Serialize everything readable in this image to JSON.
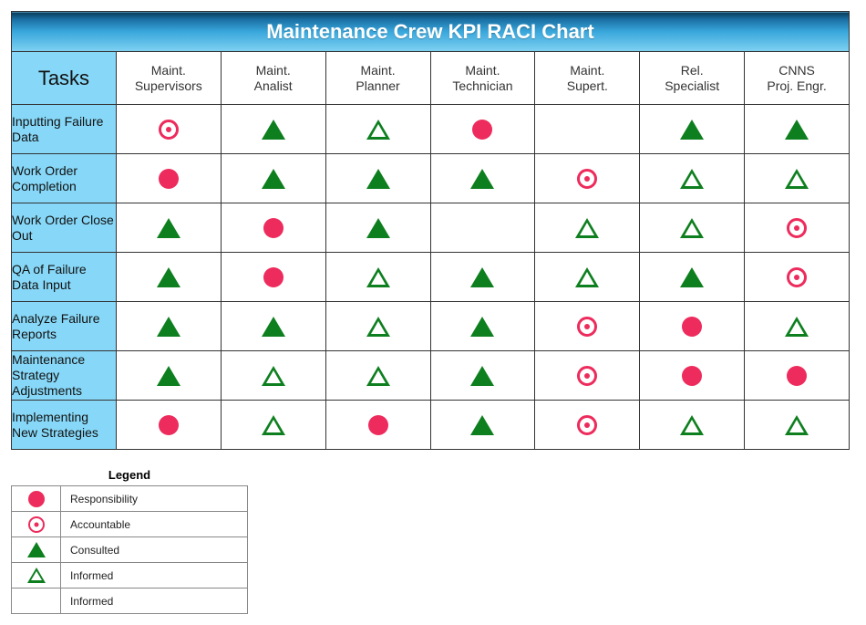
{
  "title": "Maintenance Crew KPI RACI Chart",
  "tasks_header": "Tasks",
  "roles": [
    "Maint. Supervisors",
    "Maint. Analist",
    "Maint. Planner",
    "Maint. Technician",
    "Maint. Supert.",
    "Rel. Specialist",
    "CNNS Proj. Engr."
  ],
  "tasks": [
    "Inputting Failure Data",
    "Work Order Completion",
    "Work Order Close Out",
    "QA of Failure Data Input",
    "Analyze Failure Reports",
    "Maintenance Strategy Adjustments",
    "Implementing New Strategies"
  ],
  "matrix": [
    [
      "accountable",
      "consulted",
      "informed",
      "responsibility",
      "",
      "consulted",
      "consulted"
    ],
    [
      "responsibility",
      "consulted",
      "consulted",
      "consulted",
      "accountable",
      "informed",
      "informed"
    ],
    [
      "consulted",
      "responsibility",
      "consulted",
      "",
      "informed",
      "informed",
      "accountable"
    ],
    [
      "consulted",
      "responsibility",
      "informed",
      "consulted",
      "informed",
      "consulted",
      "accountable"
    ],
    [
      "consulted",
      "consulted",
      "informed",
      "consulted",
      "accountable",
      "responsibility",
      "informed"
    ],
    [
      "consulted",
      "informed",
      "informed",
      "consulted",
      "accountable",
      "responsibility",
      "responsibility"
    ],
    [
      "responsibility",
      "informed",
      "responsibility",
      "consulted",
      "accountable",
      "informed",
      "informed"
    ]
  ],
  "legend": {
    "title": "Legend",
    "items": [
      {
        "symbol": "responsibility",
        "label": "Responsibility"
      },
      {
        "symbol": "accountable",
        "label": "Accountable"
      },
      {
        "symbol": "consulted",
        "label": "Consulted"
      },
      {
        "symbol": "informed",
        "label": "Informed"
      },
      {
        "symbol": "",
        "label": "Informed"
      }
    ]
  }
}
